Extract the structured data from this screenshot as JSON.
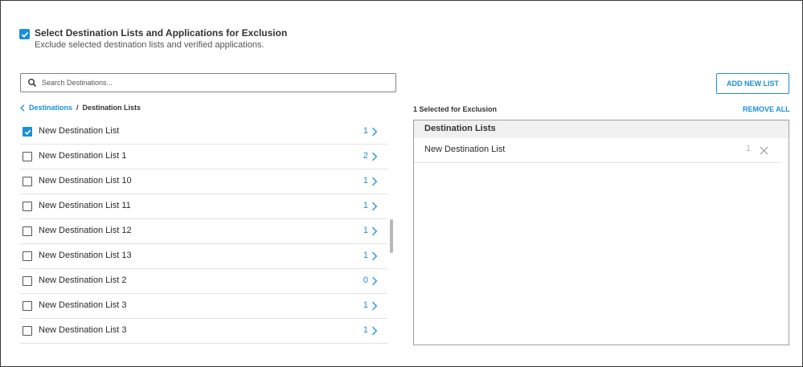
{
  "header": {
    "checkbox_checked": true,
    "title": "Select Destination Lists and Applications for Exclusion",
    "description": "Exclude selected destination lists and verified applications."
  },
  "search": {
    "placeholder": "Search Destinations...",
    "value": "",
    "icon": "search-icon"
  },
  "add_button_label": "ADD NEW LIST",
  "breadcrumb": {
    "back_label": "Destinations",
    "separator": "/",
    "current": "Destination Lists"
  },
  "destination_lists": [
    {
      "label": "New Destination List",
      "count": "1",
      "checked": true
    },
    {
      "label": "New Destination List 1",
      "count": "2",
      "checked": false
    },
    {
      "label": "New Destination List 10",
      "count": "1",
      "checked": false
    },
    {
      "label": "New Destination List 11",
      "count": "1",
      "checked": false
    },
    {
      "label": "New Destination List 12",
      "count": "1",
      "checked": false
    },
    {
      "label": "New Destination List 13",
      "count": "1",
      "checked": false
    },
    {
      "label": "New Destination List 2",
      "count": "0",
      "checked": false
    },
    {
      "label": "New Destination List 3",
      "count": "1",
      "checked": false
    },
    {
      "label": "New Destination List 3",
      "count": "1",
      "checked": false
    }
  ],
  "selection": {
    "count_label": "1 Selected for Exclusion",
    "remove_all_label": "REMOVE ALL",
    "panel_heading": "Destination Lists",
    "items": [
      {
        "label": "New Destination List",
        "count": "1"
      }
    ]
  },
  "colors": {
    "accent": "#1a8fd9",
    "border": "#9ba1a6",
    "panel_header_bg": "#f0f0f0"
  }
}
